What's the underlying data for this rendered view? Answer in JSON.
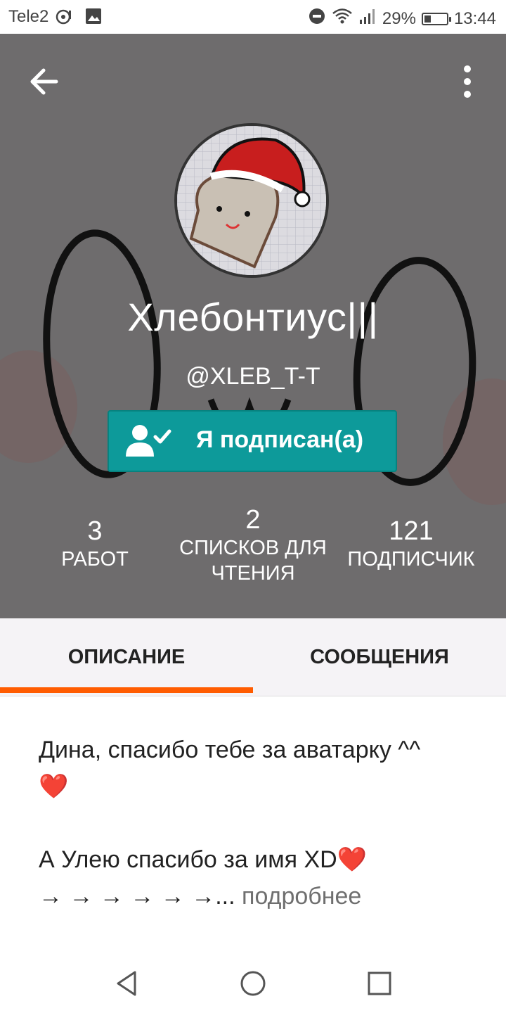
{
  "status_bar": {
    "carrier": "Tele2",
    "battery": "29%",
    "battery_level": 0.29,
    "time": "13:44",
    "icons": [
      "hotspot-icon",
      "gallery-icon",
      "dnd-icon",
      "wifi-icon",
      "signal-icon",
      "battery-icon"
    ]
  },
  "profile": {
    "name": "Хлебонтиус|||",
    "handle": "@XLEB_T-T",
    "follow_label": "Я подписан(а)"
  },
  "stats": [
    {
      "value": "3",
      "label": "РАБОТ"
    },
    {
      "value": "2",
      "label": "СПИСКОВ ДЛЯ ЧТЕНИЯ"
    },
    {
      "value": "121",
      "label": "ПОДПИСЧИК"
    }
  ],
  "tabs": [
    {
      "label": "ОПИСАНИЕ",
      "active": true
    },
    {
      "label": "СООБЩЕНИЯ",
      "active": false
    }
  ],
  "description": {
    "line1": "Дина, спасибо тебе за аватарку ^^",
    "heart1": "❤️",
    "line2": "А Улею спасибо за имя XD",
    "heart2": "❤️",
    "line3": "→ → → → → →...",
    "more": "подробнее"
  },
  "colors": {
    "accent": "#0d9a9a",
    "tab_indicator": "#ff5c00",
    "header_bg": "#6e6c6d"
  }
}
